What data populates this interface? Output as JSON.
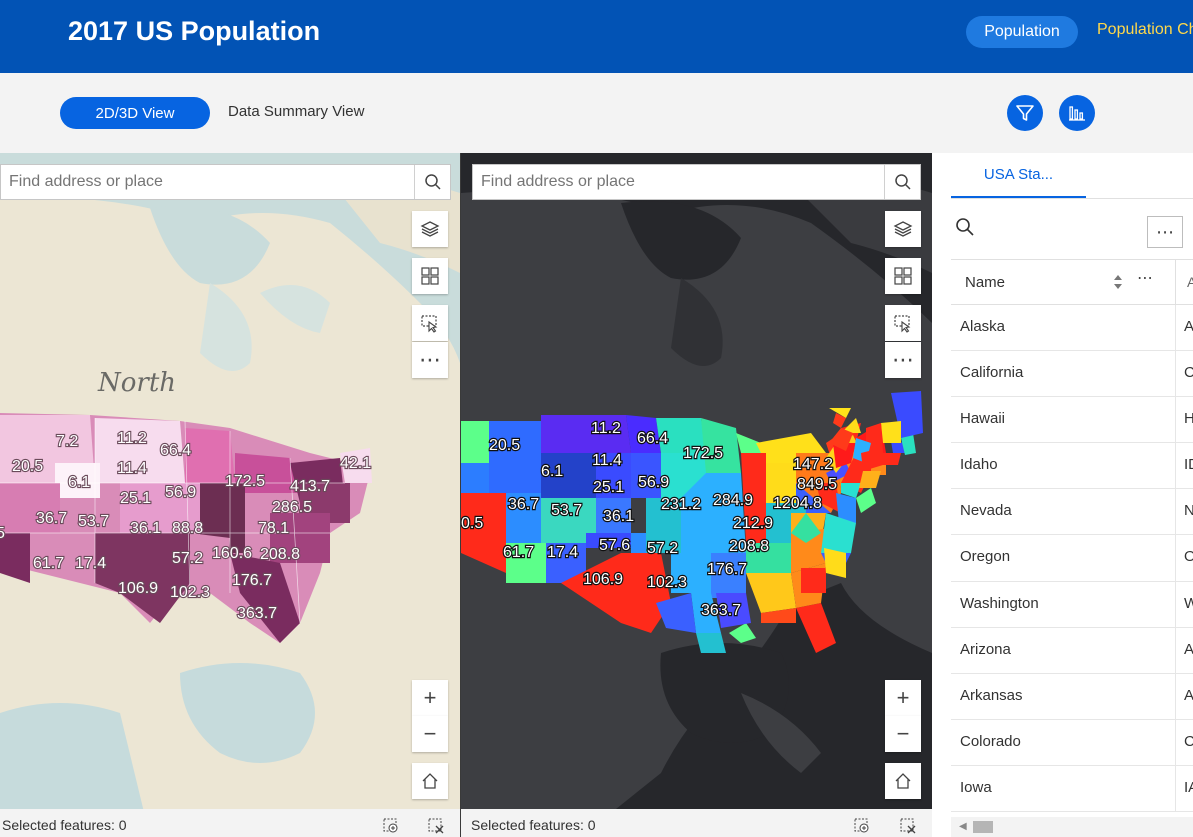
{
  "header": {
    "title": "2017 US Population",
    "tabs": [
      {
        "label": "Population",
        "active": true
      },
      {
        "label": "Population Change",
        "active": false
      }
    ]
  },
  "viewbar": {
    "tabs": [
      {
        "label": "2D/3D View",
        "active": true
      },
      {
        "label": "Data Summary View",
        "active": false
      }
    ],
    "buttons": [
      "filter-icon",
      "chart-icon"
    ]
  },
  "colors": {
    "header_bg": "#0253b5",
    "accent": "#0764e1",
    "header_inactive_tab": "#ffd84a"
  },
  "maps": {
    "left": {
      "search_placeholder": "Find address or place",
      "basemap_label": "North",
      "status": "Selected features: 0",
      "zoom_in": "+",
      "zoom_out": "−",
      "labels": [
        "7.2",
        "11.2",
        "66.4",
        "20.5",
        "6.1",
        "11.4",
        "25.1",
        "56.9",
        "172.5",
        "42.1",
        "413.7",
        "286.5",
        "36.7",
        "53.7",
        "36.1",
        "88.8",
        "78.1",
        "5",
        "61.7",
        "17.4",
        "57.2",
        "160.6",
        "208.8",
        "106.9",
        "102.3",
        "176.7",
        "363.7"
      ]
    },
    "right": {
      "search_placeholder": "Find address or place",
      "status": "Selected features: 0",
      "zoom_in": "+",
      "zoom_out": "−",
      "labels": [
        "11.2",
        "66.4",
        "20.5",
        "172.5",
        "6.1",
        "11.4",
        "147.2",
        "849.5",
        "25.1",
        "56.9",
        "284.9",
        "1204.8",
        "36.7",
        "53.7",
        "36.1",
        "231.2",
        "212.9",
        "0.5",
        "57.6",
        "57.2",
        "208.8",
        "61.7",
        "17.4",
        "176.7",
        "106.9",
        "102.3",
        "363.7"
      ]
    }
  },
  "table": {
    "tab_label": "USA Sta...",
    "columns": [
      "Name",
      "A"
    ],
    "rows": [
      {
        "name": "Alaska",
        "abbr": "A"
      },
      {
        "name": "California",
        "abbr": "C"
      },
      {
        "name": "Hawaii",
        "abbr": "H"
      },
      {
        "name": "Idaho",
        "abbr": "ID"
      },
      {
        "name": "Nevada",
        "abbr": "N"
      },
      {
        "name": "Oregon",
        "abbr": "O"
      },
      {
        "name": "Washington",
        "abbr": "W"
      },
      {
        "name": "Arizona",
        "abbr": "A"
      },
      {
        "name": "Arkansas",
        "abbr": "A"
      },
      {
        "name": "Colorado",
        "abbr": "C"
      },
      {
        "name": "Iowa",
        "abbr": "IA"
      }
    ]
  }
}
